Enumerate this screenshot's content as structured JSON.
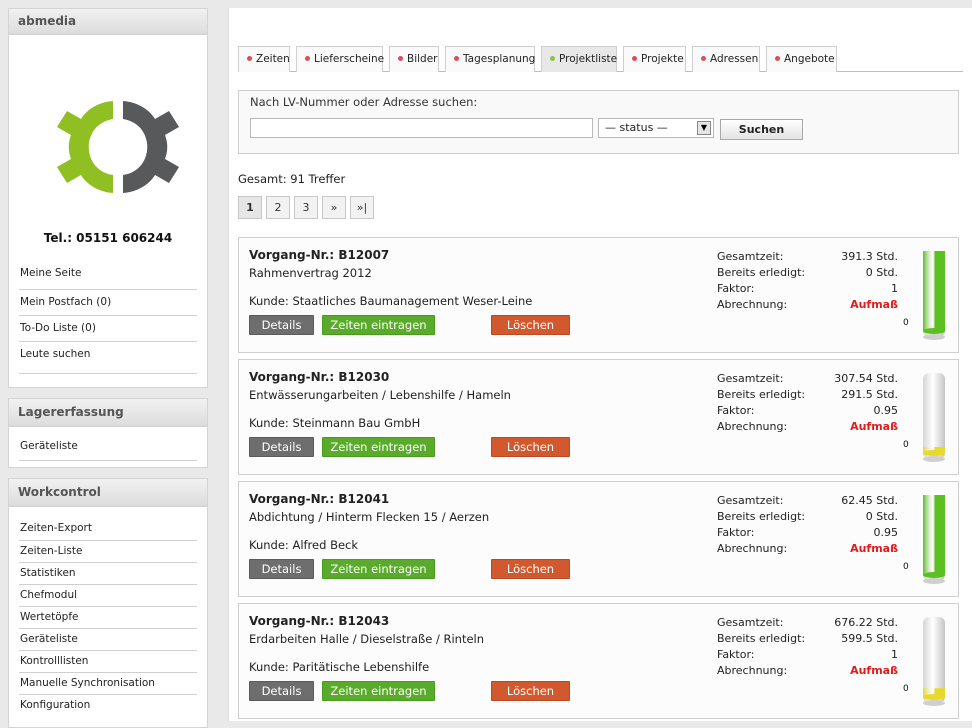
{
  "sidebar": {
    "brand": "abmedia",
    "phone": "Tel.: 05151 606244",
    "user_menu": [
      "Meine Seite",
      "Mein Postfach (0)",
      "To-Do Liste (0)",
      "Leute suchen"
    ],
    "lager": {
      "title": "Lagererfassung",
      "items": [
        "Geräteliste"
      ]
    },
    "workcontrol": {
      "title": "Workcontrol",
      "items": [
        "Zeiten-Export",
        "Zeiten-Liste",
        "Statistiken",
        "Chefmodul",
        "Wertetöpfe",
        "Geräteliste",
        "Kontrolllisten",
        "Manuelle Synchronisation",
        "Konfiguration"
      ]
    }
  },
  "tabs": [
    {
      "label": "Zeiten",
      "active": false
    },
    {
      "label": "Lieferscheine",
      "active": false
    },
    {
      "label": "Bilder",
      "active": false
    },
    {
      "label": "Tagesplanung",
      "active": false
    },
    {
      "label": "Projektliste",
      "active": true
    },
    {
      "label": "Projekte",
      "active": false
    },
    {
      "label": "Adressen",
      "active": false
    },
    {
      "label": "Angebote",
      "active": false
    }
  ],
  "search": {
    "legend": "Nach LV-Nummer oder Adresse suchen:",
    "value": "",
    "status_selected": "— status —",
    "button": "Suchen"
  },
  "total": "Gesamt: 91 Treffer",
  "pager": [
    "1",
    "2",
    "3",
    "»",
    "»|"
  ],
  "labels": {
    "gesamtzeit": "Gesamtzeit:",
    "erledigt": "Bereits erledigt:",
    "faktor": "Faktor:",
    "abrechnung": "Abrechnung:",
    "details": "Details",
    "zeiten": "Zeiten eintragen",
    "loeschen": "Löschen",
    "gauge_zero": "0"
  },
  "projects": [
    {
      "vnr": "Vorgang-Nr.: B12007",
      "desc": "Rahmenvertrag 2012",
      "kunde": "Kunde: Staatliches Baumanagement Weser-Leine",
      "gesamt": "391.3 Std.",
      "erledigt": "0 Std.",
      "faktor": "1",
      "abrechnung": "Aufmaß",
      "fill": 1.0,
      "fill_color": "green"
    },
    {
      "vnr": "Vorgang-Nr.: B12030",
      "desc": "Entwässerungarbeiten / Lebenshilfe / Hameln",
      "kunde": "Kunde: Steinmann Bau GmbH",
      "gesamt": "307.54 Std.",
      "erledigt": "291.5 Std.",
      "faktor": "0.95",
      "abrechnung": "Aufmaß",
      "fill": 0.05,
      "fill_color": "yellow"
    },
    {
      "vnr": "Vorgang-Nr.: B12041",
      "desc": "Abdichtung / Hinterm Flecken 15 / Aerzen",
      "kunde": "Kunde: Alfred Beck",
      "gesamt": "62.45 Std.",
      "erledigt": "0 Std.",
      "faktor": "0.95",
      "abrechnung": "Aufmaß",
      "fill": 1.0,
      "fill_color": "green"
    },
    {
      "vnr": "Vorgang-Nr.: B12043",
      "desc": "Erdarbeiten Halle / Dieselstraße / Rinteln",
      "kunde": "Kunde: Paritätische Lebenshilfe",
      "gesamt": "676.22 Std.",
      "erledigt": "599.5 Std.",
      "faktor": "1",
      "abrechnung": "Aufmaß",
      "fill": 0.11,
      "fill_color": "yellow"
    }
  ],
  "colors": {
    "green": "#5cbf22",
    "yellow": "#e8d92a",
    "logo_green": "#8fbf22",
    "logo_gray": "#58595b"
  }
}
